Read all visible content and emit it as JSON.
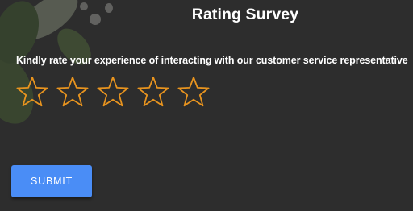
{
  "survey": {
    "title": "Rating Survey",
    "question": "Kindly rate your experience of interacting with our customer service representative",
    "rating": {
      "max": 5,
      "selected": 0,
      "star_outline_color": "#e8941f",
      "star_fill_color": "none"
    },
    "submit_label": "SUBMIT"
  },
  "theme": {
    "background": "#3a3a3a",
    "button_color": "#4a8df6",
    "text_color": "#ffffff"
  }
}
